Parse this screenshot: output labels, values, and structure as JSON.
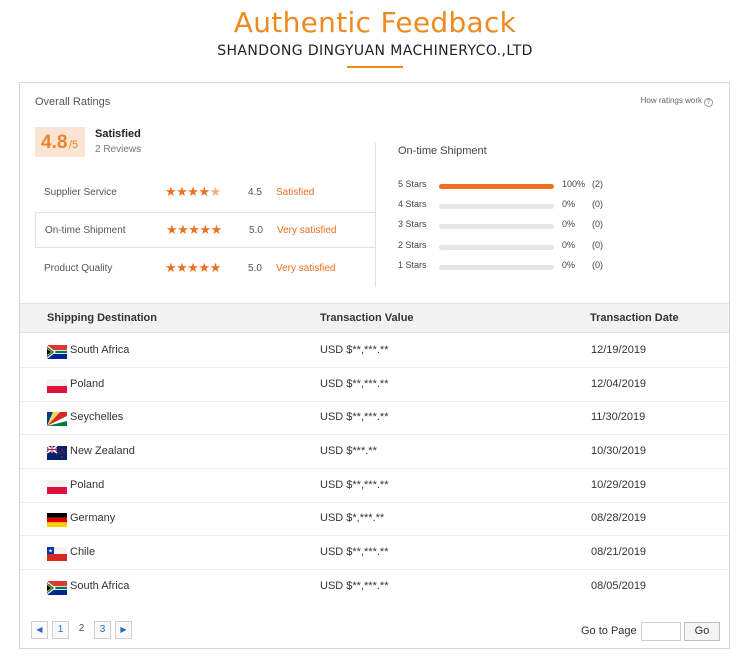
{
  "header": {
    "title": "Authentic Feedback",
    "subtitle": "SHANDONG DINGYUAN MACHINERYCO.,LTD",
    "accent_color": "#ee8a1f"
  },
  "ratings": {
    "overall_label": "Overall Ratings",
    "how_label": "How ratings work",
    "score": "4.8",
    "score_suffix": "/5",
    "satisfaction": "Satisfied",
    "reviews": "2 Reviews",
    "rows": [
      {
        "label": "Supplier Service",
        "score": "4.5",
        "stars": 4.5,
        "desc": "Satisfied"
      },
      {
        "label": "On-time Shipment",
        "score": "5.0",
        "stars": 5,
        "desc": "Very satisfied"
      },
      {
        "label": "Product Quality",
        "score": "5.0",
        "stars": 5,
        "desc": "Very satisfied"
      }
    ]
  },
  "shipment": {
    "title": "On-time Shipment",
    "distribution": [
      {
        "label": "5 Stars",
        "pct": "100%",
        "count": "(2)",
        "fraction": 1.0
      },
      {
        "label": "4 Stars",
        "pct": "0%",
        "count": "(0)",
        "fraction": 0
      },
      {
        "label": "3 Stars",
        "pct": "0%",
        "count": "(0)",
        "fraction": 0
      },
      {
        "label": "2 Stars",
        "pct": "0%",
        "count": "(0)",
        "fraction": 0
      },
      {
        "label": "1 Stars",
        "pct": "0%",
        "count": "(0)",
        "fraction": 0
      }
    ]
  },
  "table": {
    "headers": {
      "destination": "Shipping Destination",
      "value": "Transaction Value",
      "date": "Transaction Date"
    },
    "rows": [
      {
        "flag": "south-africa-flag",
        "dest": "South Africa",
        "value": "USD $**,***.**",
        "date": "12/19/2019"
      },
      {
        "flag": "poland-flag",
        "dest": "Poland",
        "value": "USD $**,***.**",
        "date": "12/04/2019"
      },
      {
        "flag": "seychelles-flag",
        "dest": "Seychelles",
        "value": "USD $**,***.**",
        "date": "11/30/2019"
      },
      {
        "flag": "new-zealand-flag",
        "dest": "New Zealand",
        "value": "USD $***.**",
        "date": "10/30/2019"
      },
      {
        "flag": "poland-flag",
        "dest": "Poland",
        "value": "USD $**,***.**",
        "date": "10/29/2019"
      },
      {
        "flag": "germany-flag",
        "dest": "Germany",
        "value": "USD $*,***.**",
        "date": "08/28/2019"
      },
      {
        "flag": "chile-flag",
        "dest": "Chile",
        "value": "USD $**,***.**",
        "date": "08/21/2019"
      },
      {
        "flag": "south-africa-flag",
        "dest": "South Africa",
        "value": "USD $**,***.**",
        "date": "08/05/2019"
      }
    ]
  },
  "pagination": {
    "prev": "◀",
    "pages": [
      "1",
      "2",
      "3"
    ],
    "next": "▶",
    "goto_label": "Go to Page",
    "goto_button": "Go"
  }
}
